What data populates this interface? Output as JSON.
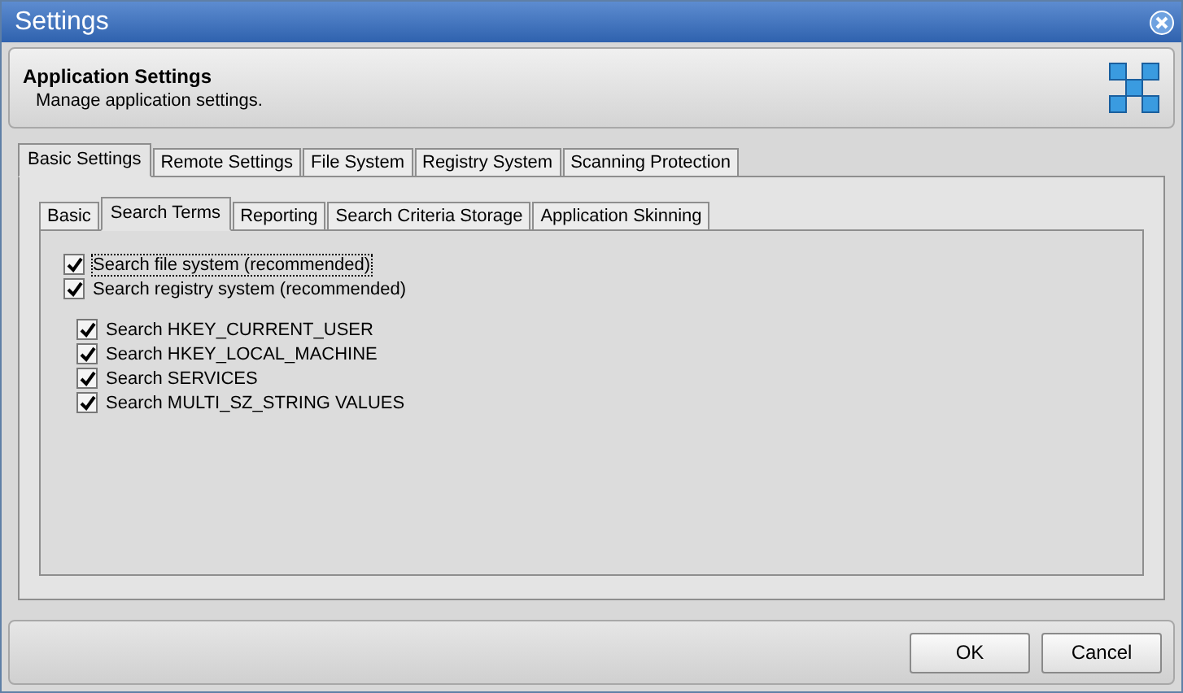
{
  "window": {
    "title": "Settings"
  },
  "header": {
    "title": "Application Settings",
    "subtitle": "Manage application settings."
  },
  "tabs": [
    {
      "label": "Basic Settings",
      "selected": true
    },
    {
      "label": "Remote Settings",
      "selected": false
    },
    {
      "label": "File System",
      "selected": false
    },
    {
      "label": "Registry System",
      "selected": false
    },
    {
      "label": "Scanning Protection",
      "selected": false
    }
  ],
  "subtabs": [
    {
      "label": "Basic",
      "selected": false
    },
    {
      "label": "Search Terms",
      "selected": true
    },
    {
      "label": "Reporting",
      "selected": false
    },
    {
      "label": "Search Criteria Storage",
      "selected": false
    },
    {
      "label": "Application Skinning",
      "selected": false
    }
  ],
  "options": [
    {
      "label": "Search file system (recommended)",
      "checked": true,
      "focused": true
    },
    {
      "label": "Search registry system (recommended)",
      "checked": true,
      "focused": false,
      "children": [
        {
          "label": "Search HKEY_CURRENT_USER",
          "checked": true
        },
        {
          "label": "Search HKEY_LOCAL_MACHINE",
          "checked": true
        },
        {
          "label": "Search SERVICES",
          "checked": true
        },
        {
          "label": "Search MULTI_SZ_STRING VALUES",
          "checked": true
        }
      ]
    }
  ],
  "buttons": [
    "OK",
    "Cancel"
  ]
}
